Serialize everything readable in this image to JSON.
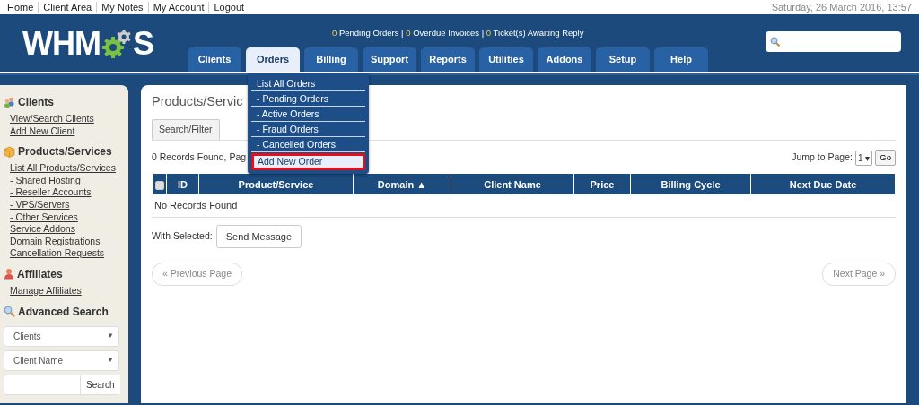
{
  "top_links": [
    "Home",
    "Client Area",
    "My Notes",
    "My Account",
    "Logout"
  ],
  "datetime": "Saturday, 26 March 2016, 13:57",
  "logo": {
    "before": "WHM",
    "after": "S"
  },
  "notices": {
    "separator": "|",
    "items": [
      {
        "count": "0",
        "label": "Pending Orders"
      },
      {
        "count": "0",
        "label": "Overdue Invoices"
      },
      {
        "count": "0",
        "label": "Ticket(s) Awaiting Reply"
      }
    ]
  },
  "tabs": [
    {
      "label": "Clients",
      "selected": false
    },
    {
      "label": "Orders",
      "selected": true
    },
    {
      "label": "Billing",
      "selected": false
    },
    {
      "label": "Support",
      "selected": false
    },
    {
      "label": "Reports",
      "selected": false
    },
    {
      "label": "Utilities",
      "selected": false
    },
    {
      "label": "Addons",
      "selected": false
    },
    {
      "label": "Setup",
      "selected": false
    },
    {
      "label": "Help",
      "selected": false
    }
  ],
  "dropdown": {
    "items": [
      {
        "label": "List All Orders",
        "selected": false
      },
      {
        "label": "- Pending Orders",
        "selected": false
      },
      {
        "label": "- Active Orders",
        "selected": false
      },
      {
        "label": "- Fraud Orders",
        "selected": false
      },
      {
        "label": "- Cancelled Orders",
        "selected": false
      },
      {
        "label": "Add New Order",
        "selected": true
      }
    ]
  },
  "sidebar": {
    "sections": [
      {
        "title": "Clients",
        "links": [
          "View/Search Clients",
          "Add New Client"
        ]
      },
      {
        "title": "Products/Services",
        "links": [
          "List All Products/Services",
          "- Shared Hosting",
          "- Reseller Accounts",
          "- VPS/Servers",
          "- Other Services",
          "Service Addons",
          "Domain Registrations",
          "Cancellation Requests"
        ]
      },
      {
        "title": "Affiliates",
        "links": [
          "Manage Affiliates"
        ]
      },
      {
        "title": "Advanced Search"
      }
    ],
    "advanced_search": {
      "selects": [
        {
          "value": "Clients",
          "arrow": "▼"
        },
        {
          "value": "Client Name",
          "arrow": "▼"
        }
      ],
      "button": "Search"
    }
  },
  "main": {
    "title": "Products/Servic",
    "filter_tab": "Search/Filter",
    "records": "0 Records Found, Pag",
    "jump_label": "Jump to Page:",
    "jump_value": "1",
    "jump_arrow": "▾",
    "go": "Go",
    "table": {
      "columns": [
        {
          "kind": "checkbox",
          "checked": false
        },
        {
          "kind": "text",
          "label": "ID"
        },
        {
          "kind": "text",
          "label": "Product/Service"
        },
        {
          "kind": "sorted",
          "label": "Domain",
          "sort": "▲"
        },
        {
          "kind": "text",
          "label": "Client Name"
        },
        {
          "kind": "text",
          "label": "Price"
        },
        {
          "kind": "text",
          "label": "Billing Cycle"
        },
        {
          "kind": "text",
          "label": "Next Due Date"
        }
      ],
      "empty": "No Records Found"
    },
    "with_selected": "With Selected:",
    "send_message": "Send Message",
    "prev": "« Previous Page",
    "next": "Next Page »"
  }
}
